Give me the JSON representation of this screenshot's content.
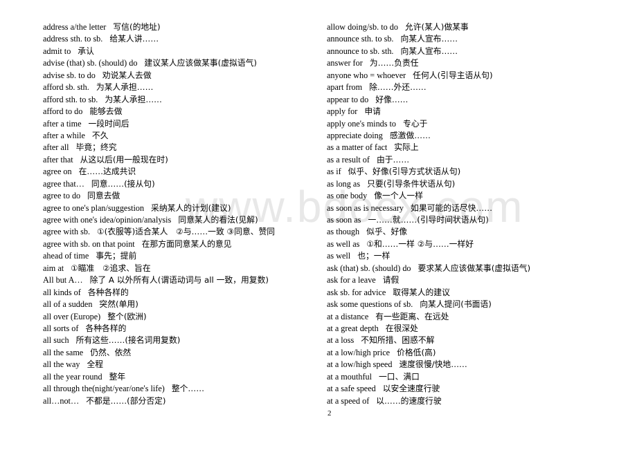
{
  "watermark": "www.bdocx.com",
  "page_number": "2",
  "left_column": [
    {
      "en": "address a/the letter",
      "zh": "写信(的地址)"
    },
    {
      "en": "address sth. to sb.",
      "zh": "给某人讲……"
    },
    {
      "en": "admit to",
      "zh": "承认"
    },
    {
      "en": "advise (that) sb. (should) do",
      "zh": "建议某人应该做某事(虚拟语气)"
    },
    {
      "en": "advise sb. to do",
      "zh": "劝说某人去做"
    },
    {
      "en": "afford sb. sth.",
      "zh": "为某人承担……"
    },
    {
      "en": "afford sth. to sb.",
      "zh": "为某人承担……"
    },
    {
      "en": "afford to do",
      "zh": "能够去做"
    },
    {
      "en": "after a time",
      "zh": "一段时间后"
    },
    {
      "en": "after a while",
      "zh": "不久"
    },
    {
      "en": "after all",
      "zh": "毕竟；终究"
    },
    {
      "en": "after that",
      "zh": "从这以后(用一般现在时)"
    },
    {
      "en": "agree on",
      "zh": "在……达成共识"
    },
    {
      "en": "agree that…",
      "zh": "同意……(接从句)"
    },
    {
      "en": "agree to do",
      "zh": "同意去做"
    },
    {
      "en": "agree to one's plan/suggestion",
      "zh": "采纳某人的计划(建议)"
    },
    {
      "en": "agree with one's idea/opinion/analysis",
      "zh": "同意某人的看法(见解)"
    },
    {
      "en": "agree with sb.",
      "zh": "①(衣服等)适合某人　②与……一致 ③同意、赞同"
    },
    {
      "en": "agree with sb. on that point",
      "zh": "在那方面同意某人的意见"
    },
    {
      "en": "ahead of time",
      "zh": "事先；提前"
    },
    {
      "en": "aim at",
      "zh": "①瞄准　②追求、旨在"
    },
    {
      "en": "All but A…",
      "zh": "除了 A 以外所有人(谓语动词与 all 一致，用复数)"
    },
    {
      "en": "all kinds of",
      "zh": "各种各样的"
    },
    {
      "en": "all of a sudden",
      "zh": "突然(单用)"
    },
    {
      "en": "all over (Europe)",
      "zh": "整个(欧洲)"
    },
    {
      "en": "all sorts of",
      "zh": "各种各样的"
    },
    {
      "en": "all such",
      "zh": "所有这些……(接名词用复数)"
    },
    {
      "en": "all the same",
      "zh": "仍然、依然"
    },
    {
      "en": "all the way",
      "zh": "全程"
    },
    {
      "en": "all the year round",
      "zh": "整年"
    },
    {
      "en": "all through the(night/year/one's life)",
      "zh": "整个……"
    },
    {
      "en": "all…not…",
      "zh": "不都是……(部分否定)"
    }
  ],
  "right_column": [
    {
      "en": "allow doing/sb. to do",
      "zh": "允许(某人)做某事"
    },
    {
      "en": "announce sth. to sb.",
      "zh": "向某人宣布……"
    },
    {
      "en": "announce to sb. sth.",
      "zh": "向某人宣布……"
    },
    {
      "en": "answer for",
      "zh": "为……负责任"
    },
    {
      "en": "anyone who = whoever",
      "zh": "任何人(引导主语从句)"
    },
    {
      "en": "apart from",
      "zh": "除……外还……"
    },
    {
      "en": "appear to do",
      "zh": "好像……"
    },
    {
      "en": "apply for",
      "zh": "申请"
    },
    {
      "en": "apply one's minds to",
      "zh": "专心于"
    },
    {
      "en": "appreciate doing",
      "zh": "感激做……"
    },
    {
      "en": "as a matter of fact",
      "zh": "实际上"
    },
    {
      "en": "as a result of",
      "zh": "由于……"
    },
    {
      "en": "as if",
      "zh": "似乎、好像(引导方式状语从句)"
    },
    {
      "en": "as long as",
      "zh": "只要(引导条件状语从句)"
    },
    {
      "en": "as one body",
      "zh": "像一个人一样"
    },
    {
      "en": "as soon as is necessary",
      "zh": "如果可能的话尽快……"
    },
    {
      "en": "as soon as",
      "zh": "一……就……(引导时间状语从句)"
    },
    {
      "en": "as though",
      "zh": "似乎、好像"
    },
    {
      "en": "as well as",
      "zh": "①和……一样 ②与……一样好"
    },
    {
      "en": "as well",
      "zh": "也；一样"
    },
    {
      "en": "ask (that) sb. (should) do",
      "zh": "要求某人应该做某事(虚拟语气)"
    },
    {
      "en": "ask for a leave",
      "zh": "请假"
    },
    {
      "en": "ask sb. for advice",
      "zh": "取得某人的建议"
    },
    {
      "en": "ask some questions of sb.",
      "zh": "向某人提问(书面语)"
    },
    {
      "en": "at a distance",
      "zh": "有一些距离、在远处"
    },
    {
      "en": "at a great depth",
      "zh": "在很深处"
    },
    {
      "en": "at a loss",
      "zh": "不知所措、困惑不解"
    },
    {
      "en": "at a low/high price",
      "zh": "价格低(高)"
    },
    {
      "en": "at a low/high speed",
      "zh": "速度很慢/快地……"
    },
    {
      "en": "at a mouthful",
      "zh": "一口、满口"
    },
    {
      "en": "at a safe speed",
      "zh": "以安全速度行驶"
    },
    {
      "en": "at a speed of",
      "zh": "以……的速度行驶"
    }
  ]
}
